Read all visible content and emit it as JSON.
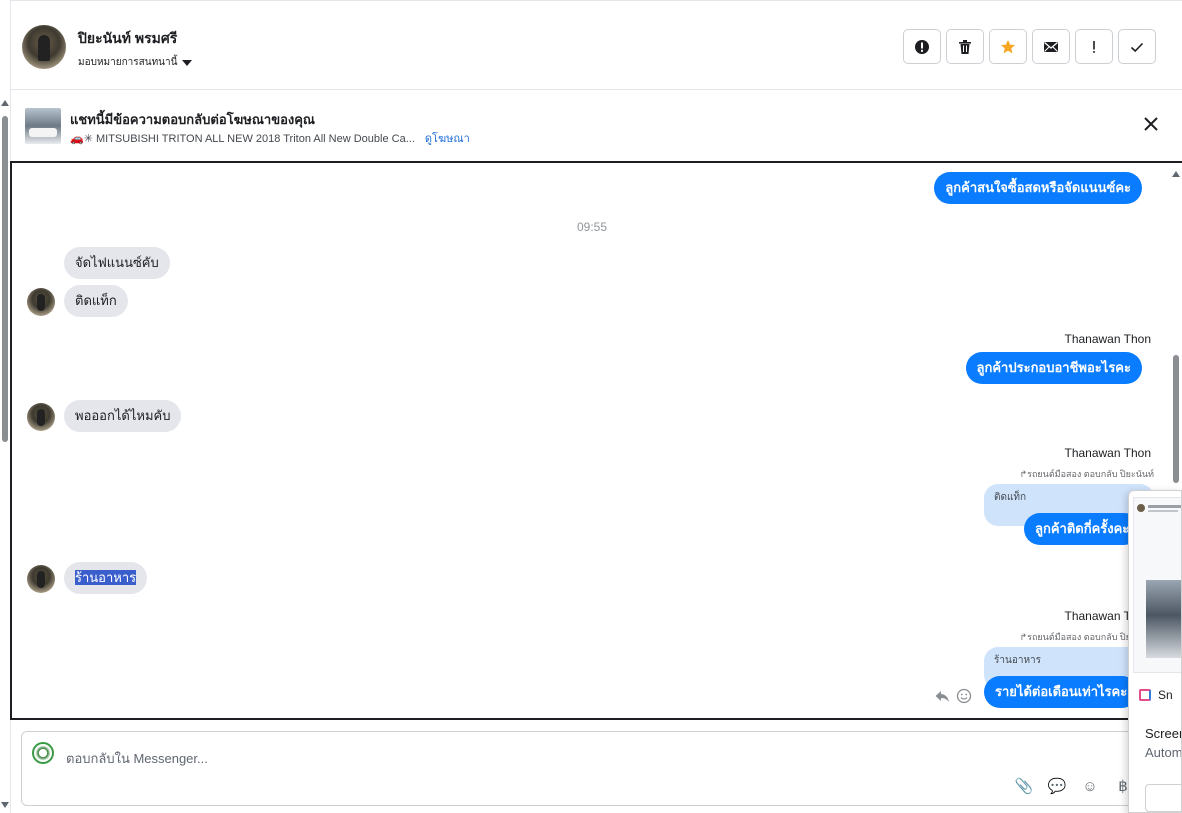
{
  "header": {
    "contact_name": "ปิยะนันท์ พรมศรี",
    "assign_label": "มอบหมายการสนทนานี้",
    "actions": [
      {
        "icon": "spam-icon",
        "label": "!"
      },
      {
        "icon": "trash-icon",
        "label": ""
      },
      {
        "icon": "star-icon",
        "label": ""
      },
      {
        "icon": "mail-icon",
        "label": ""
      },
      {
        "icon": "priority-icon",
        "label": "!"
      },
      {
        "icon": "check-icon",
        "label": ""
      }
    ],
    "star_color": "#f5a623"
  },
  "ad": {
    "title": "แชทนี้มีข้อความตอบกลับต่อโฆษณาของคุณ",
    "subtitle": "🚗✳ MITSUBISHI TRITON ALL NEW 2018 Triton All New Double Ca...",
    "view_link": "ดูโฆษณา"
  },
  "chat": {
    "timestamp": "09:55",
    "messages": {
      "out1": "ลูกค้าสนใจซื้อสดหรือจัดแนนซ์คะ",
      "in1": "จัดไฟแนนซ์คับ",
      "in2": "ติดแท็ก",
      "sender1": "Thanawan Thon",
      "out2": "ลูกค้าประกอบอาชีพอะไรคะ",
      "in3": "พอออกได้ไหมคับ",
      "sender2": "Thanawan Thon",
      "reply_note1": "รถยนต์มือสอง ตอบกลับ ปิยะนันท์",
      "quoted1": "ติดแท็ก",
      "out3": "ลูกค้าติดกี่ครั้งคะ",
      "in4": "ร้านอาหาร",
      "sender3": "Thanawan Thon",
      "reply_note2": "รถยนต์มือสอง ตอบกลับ ปิยะนันท์",
      "quoted2": "ร้านอาหาร",
      "out4": "รายได้ต่อเดือนเท่าไรคะ"
    },
    "outgoing_color": "#0a7cff",
    "incoming_color": "#e4e6eb"
  },
  "composer": {
    "placeholder": "ตอบกลับใน Messenger...",
    "tools": [
      {
        "icon": "attachment-icon",
        "glyph": "📎"
      },
      {
        "icon": "saved-replies-icon",
        "glyph": "💬"
      },
      {
        "icon": "emoji-icon",
        "glyph": "☺"
      },
      {
        "icon": "baht-icon",
        "glyph": "฿"
      }
    ]
  },
  "snip_panel": {
    "app_label": "Sn",
    "title": "Screen",
    "subtitle": "Autom"
  }
}
